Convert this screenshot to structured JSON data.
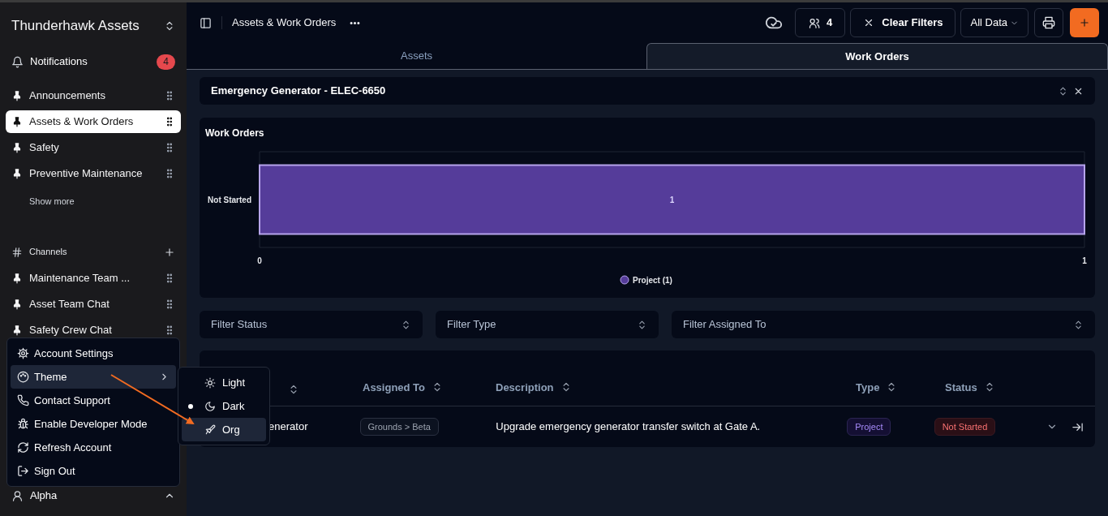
{
  "sidebar": {
    "workspace": "Thunderhawk Assets",
    "notifications": {
      "label": "Notifications",
      "count": "4"
    },
    "pinned": [
      {
        "label": "Announcements",
        "selected": false
      },
      {
        "label": "Assets & Work Orders",
        "selected": true
      },
      {
        "label": "Safety",
        "selected": false
      },
      {
        "label": "Preventive Maintenance",
        "selected": false
      }
    ],
    "show_more": "Show more",
    "channels": {
      "label": "Channels",
      "items": [
        {
          "label": "Maintenance Team ...",
          "selected": false
        },
        {
          "label": "Asset Team Chat",
          "selected": false
        },
        {
          "label": "Safety Crew Chat",
          "selected": false
        }
      ]
    },
    "user": "Alpha"
  },
  "account_menu": {
    "items": [
      {
        "label": "Account Settings",
        "expanded": false
      },
      {
        "label": "Theme",
        "expanded": true
      },
      {
        "label": "Contact Support",
        "expanded": false
      },
      {
        "label": "Enable Developer Mode",
        "expanded": false
      },
      {
        "label": "Refresh Account",
        "expanded": false
      },
      {
        "label": "Sign Out",
        "expanded": false
      }
    ],
    "theme_submenu": [
      {
        "label": "Light",
        "selected": false,
        "highlighted": false
      },
      {
        "label": "Dark",
        "selected": true,
        "highlighted": false
      },
      {
        "label": "Org",
        "selected": false,
        "highlighted": true
      }
    ]
  },
  "topbar": {
    "title": "Assets & Work Orders",
    "collaborators": "4",
    "clear_filters": "Clear Filters",
    "data_scope": "All Data"
  },
  "tabs": [
    {
      "label": "Assets",
      "selected": false
    },
    {
      "label": "Work Orders",
      "selected": true
    }
  ],
  "asset_header": {
    "title": "Emergency Generator - ELEC-6650"
  },
  "chart_panel": {
    "title": "Work Orders",
    "chart_data": {
      "type": "bar",
      "orientation": "horizontal",
      "categories": [
        "Not Started"
      ],
      "series": [
        {
          "name": "Project (1)",
          "color": "#553c9a",
          "values": [
            1
          ]
        }
      ],
      "xlim": [
        0,
        1
      ],
      "xticks": [
        0,
        1
      ],
      "data_labels": true
    }
  },
  "filters": [
    {
      "label": "Filter Status"
    },
    {
      "label": "Filter Type"
    },
    {
      "label": "Filter Assigned To"
    }
  ],
  "table": {
    "columns": [
      {
        "label": "Assigned To"
      },
      {
        "label": "Description"
      },
      {
        "label": "Type"
      },
      {
        "label": "Status"
      }
    ],
    "rows": [
      {
        "name": "enerator",
        "assigned_to": "Grounds > Beta",
        "description": "Upgrade emergency generator transfer switch at Gate A.",
        "type": "Project",
        "status": "Not Started"
      }
    ]
  }
}
